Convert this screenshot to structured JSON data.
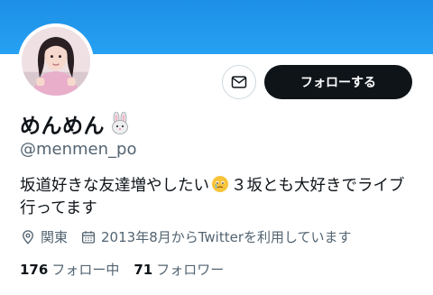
{
  "colors": {
    "banner": "#1d9bf0",
    "follow_bg": "#0f1419",
    "muted": "#536471"
  },
  "actions": {
    "message_icon": "envelope-icon",
    "follow_label": "フォローする"
  },
  "profile": {
    "display_name": "めんめん",
    "name_emoji": "rabbit-face-icon",
    "handle": "@menmen_po",
    "bio_line1_a": "坂道好きな友達増やしたい",
    "bio_emoji": "face-holding-back-tears-icon",
    "bio_line1_b": "３坂とも大好きでライブ",
    "bio_line2": "行ってます",
    "location": "関東",
    "location_icon": "location-pin-icon",
    "joined": "2013年8月からTwitterを利用しています",
    "joined_icon": "calendar-icon"
  },
  "stats": {
    "following_count": "176",
    "following_label": "フォロー中",
    "followers_count": "71",
    "followers_label": "フォロワー"
  }
}
